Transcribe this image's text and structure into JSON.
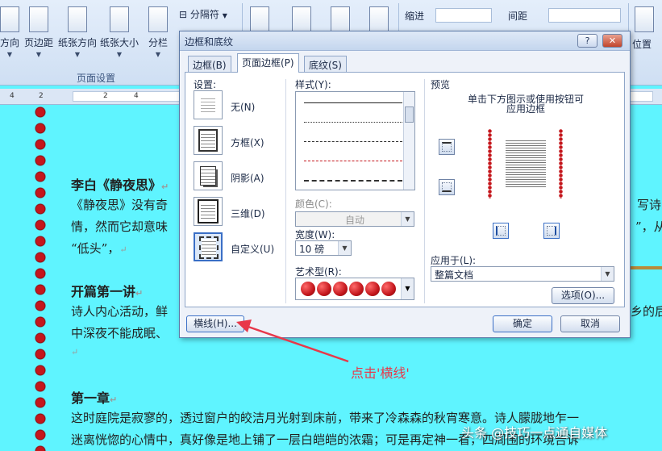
{
  "ribbon": {
    "buttons": [
      {
        "label": "方向",
        "name": "orientation"
      },
      {
        "label": "页边距",
        "name": "margins"
      },
      {
        "label": "纸张方向",
        "name": "paper-orientation"
      },
      {
        "label": "纸张大小",
        "name": "paper-size"
      },
      {
        "label": "分栏",
        "name": "columns"
      }
    ],
    "separator_label": "分隔符",
    "group_label": "页面设置",
    "indent_label": "缩进",
    "spacing_label": "间距",
    "position_label": "位置"
  },
  "ruler": {
    "numbers": [
      "4",
      "2",
      "2",
      "4"
    ]
  },
  "document": {
    "heading1": "李白《静夜思》",
    "para1_line1": "《静夜思》没有奇",
    "para1_line1_tail": "写诗",
    "para1_line2": "情，然而它却意味",
    "para1_line2_tail": "”，从",
    "para1_line3": "“低头”，",
    "heading2": "开篇第一讲",
    "para2_line1": "诗人内心活动，鲜",
    "para2_line1_tail": "乡的后",
    "para2_line2": "中深夜不能成眠、",
    "heading3": "第一章",
    "para3_line1": "这时庭院是寂寥的，透过窗户的皎洁月光射到床前，带来了冷森森的秋宵寒意。诗人朦胧地乍一",
    "para3_line2": "迷离恍惚的心情中，真好像是地上铺了一层白皑皑的浓霜；可是再定神一看，四周围的环境告诉",
    "para_mark": "↵"
  },
  "dialog": {
    "title": "边框和底纹",
    "help": "?",
    "close": "✕",
    "tabs": [
      "边框(B)",
      "页面边框(P)",
      "底纹(S)"
    ],
    "active_tab": 1,
    "settings_label": "设置:",
    "settings": [
      "无(N)",
      "方框(X)",
      "阴影(A)",
      "三维(D)",
      "自定义(U)"
    ],
    "style_label": "样式(Y):",
    "color_label": "颜色(C):",
    "color_value": "自动",
    "width_label": "宽度(W):",
    "width_value": "10 磅",
    "art_label": "艺术型(R):",
    "preview_label": "预览",
    "preview_hint_line1": "单击下方图示或使用按钮可",
    "preview_hint_line2": "应用边框",
    "apply_label": "应用于(L):",
    "apply_value": "整篇文档",
    "options_button": "选项(O)...",
    "hline_button": "横线(H)...",
    "ok_button": "确定",
    "cancel_button": "取消"
  },
  "annotation": {
    "text": "点击'横线'",
    "color": "#e8384a"
  },
  "watermark": "头条 @技巧一点通自媒体"
}
